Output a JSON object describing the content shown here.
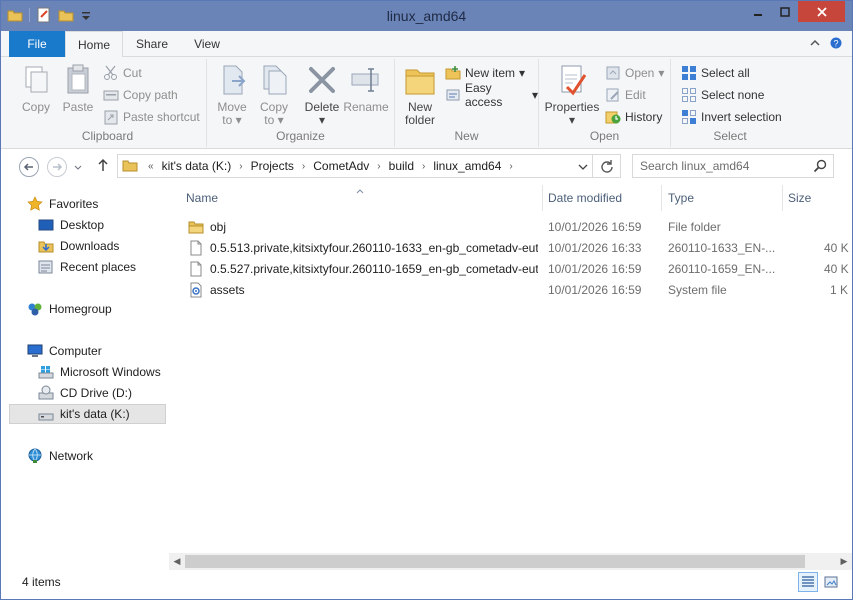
{
  "window": {
    "title": "linux_amd64"
  },
  "ribbon_tabs": [
    "File",
    "Home",
    "Share",
    "View"
  ],
  "ribbon": {
    "clipboard": {
      "label": "Clipboard",
      "copy": "Copy",
      "paste": "Paste",
      "cut": "Cut",
      "copy_path": "Copy path",
      "paste_shortcut": "Paste shortcut"
    },
    "organize": {
      "label": "Organize",
      "move_to": "Move",
      "move_to2": "to",
      "copy_to": "Copy",
      "copy_to2": "to",
      "delete": "Delete",
      "rename": "Rename"
    },
    "new": {
      "label": "New",
      "new_folder": "New",
      "new_folder2": "folder",
      "new_item": "New item",
      "easy_access": "Easy access"
    },
    "open": {
      "label": "Open",
      "properties": "Properties",
      "open": "Open",
      "edit": "Edit",
      "history": "History"
    },
    "select": {
      "label": "Select",
      "select_all": "Select all",
      "select_none": "Select none",
      "invert_selection": "Invert selection"
    }
  },
  "address": {
    "crumbs": [
      "kit's data (K:)",
      "Projects",
      "CometAdv",
      "build",
      "linux_amd64"
    ],
    "prefix": "«"
  },
  "search": {
    "placeholder": "Search linux_amd64"
  },
  "nav": {
    "favorites": "Favorites",
    "desktop": "Desktop",
    "downloads": "Downloads",
    "recent": "Recent places",
    "homegroup": "Homegroup",
    "computer": "Computer",
    "windows": "Microsoft Windows",
    "cd": "CD Drive (D:)",
    "kits": "kit's data (K:)",
    "network": "Network"
  },
  "columns": {
    "name": "Name",
    "date": "Date modified",
    "type": "Type",
    "size": "Size"
  },
  "files": [
    {
      "name": "obj",
      "date": "10/01/2026 16:59",
      "type": "File folder",
      "size": "",
      "icon": "folder-icon"
    },
    {
      "name": "0.5.513.private,kitsixtyfour.260110-1633_en-gb_cometadv-eut",
      "date": "10/01/2026 16:33",
      "type": "260110-1633_EN-...",
      "size": "40 K",
      "icon": "file-icon"
    },
    {
      "name": "0.5.527.private,kitsixtyfour.260110-1659_en-gb_cometadv-eut",
      "date": "10/01/2026 16:59",
      "type": "260110-1659_EN-...",
      "size": "40 K",
      "icon": "file-icon"
    },
    {
      "name": "assets",
      "date": "10/01/2026 16:59",
      "type": "System file",
      "size": "1 K",
      "icon": "system-file-icon"
    }
  ],
  "status": {
    "items": "4 items"
  },
  "colors": {
    "accent": "#1979ca",
    "title_bar": "#6b84b8",
    "close": "#c7463c"
  }
}
